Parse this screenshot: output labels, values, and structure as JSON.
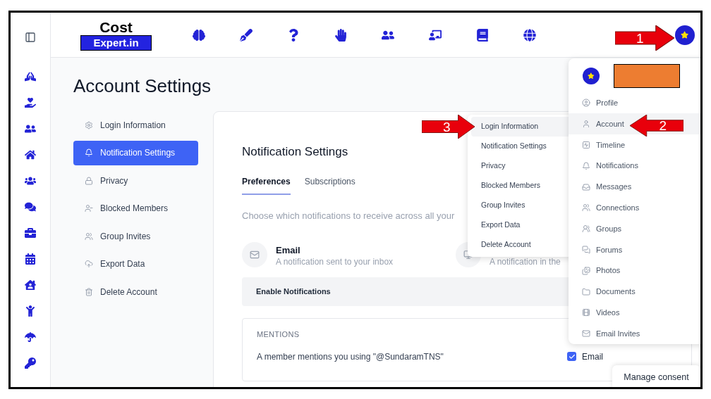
{
  "logo": {
    "line1": "Cost",
    "line2": "Expert.in"
  },
  "page_title": "Account Settings",
  "settings_nav": [
    {
      "label": "Login Information",
      "selected": false
    },
    {
      "label": "Notification Settings",
      "selected": true
    },
    {
      "label": "Privacy",
      "selected": false
    },
    {
      "label": "Blocked Members",
      "selected": false
    },
    {
      "label": "Group Invites",
      "selected": false
    },
    {
      "label": "Export Data",
      "selected": false
    },
    {
      "label": "Delete Account",
      "selected": false
    }
  ],
  "panel": {
    "title": "Notification Settings",
    "tabs": [
      {
        "label": "Preferences",
        "selected": true
      },
      {
        "label": "Subscriptions",
        "selected": false
      }
    ],
    "description": "Choose which notifications to receive across all your",
    "channels": [
      {
        "title": "Email",
        "description": "A notification sent to your inbox"
      },
      {
        "description": "A notification in the"
      }
    ],
    "enable_header": "Enable Notifications",
    "section": {
      "heading": "MENTIONS",
      "rows": [
        {
          "text": "A member mentions you using \"@SundaramTNS\"",
          "options": [
            {
              "label": "Email",
              "checked": true
            }
          ]
        }
      ]
    }
  },
  "profile_menu": {
    "items": [
      {
        "label": "Profile",
        "selected": false
      },
      {
        "label": "Account",
        "selected": true
      },
      {
        "label": "Timeline",
        "selected": false
      },
      {
        "label": "Notifications",
        "selected": false
      },
      {
        "label": "Messages",
        "selected": false
      },
      {
        "label": "Connections",
        "selected": false
      },
      {
        "label": "Groups",
        "selected": false
      },
      {
        "label": "Forums",
        "selected": false
      },
      {
        "label": "Photos",
        "selected": false
      },
      {
        "label": "Documents",
        "selected": false
      },
      {
        "label": "Videos",
        "selected": false
      },
      {
        "label": "Email Invites",
        "selected": false
      }
    ]
  },
  "account_submenu": {
    "items": [
      {
        "label": "Login Information",
        "selected": true
      },
      {
        "label": "Notification Settings",
        "selected": false
      },
      {
        "label": "Privacy",
        "selected": false
      },
      {
        "label": "Blocked Members",
        "selected": false
      },
      {
        "label": "Group Invites",
        "selected": false
      },
      {
        "label": "Export Data",
        "selected": false
      },
      {
        "label": "Delete Account",
        "selected": false
      }
    ]
  },
  "consent_button": "Manage consent",
  "annotations": [
    {
      "number": "1",
      "kind": "right"
    },
    {
      "number": "2",
      "kind": "left"
    },
    {
      "number": "3",
      "kind": "right"
    }
  ]
}
